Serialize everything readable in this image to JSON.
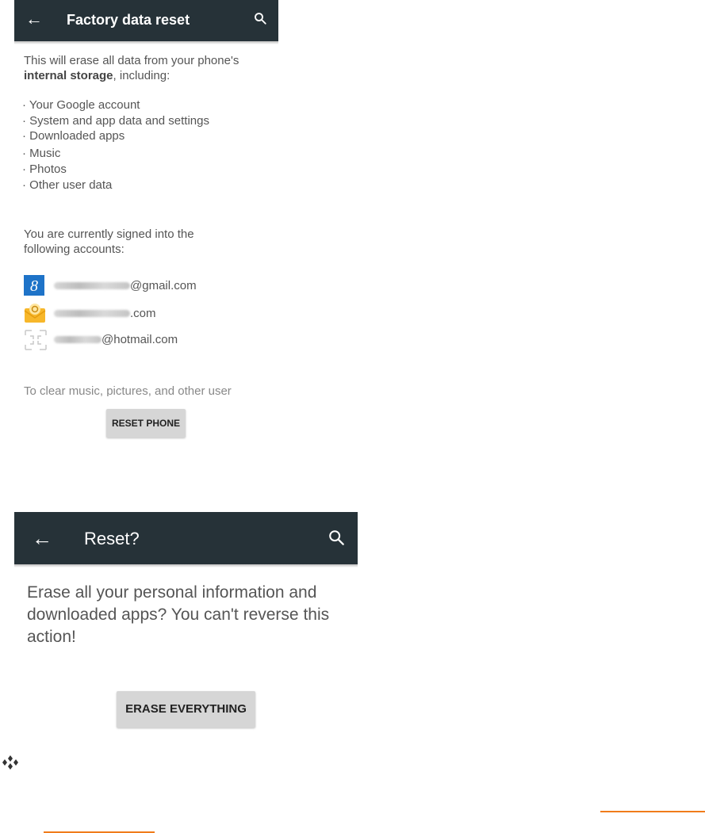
{
  "screen1": {
    "appbar": {
      "back_icon": "arrow-back-icon",
      "title": "Factory data reset",
      "search_icon": "search-icon",
      "color": "#263238"
    },
    "intro_part1": "This will erase all data from your phone's",
    "intro_bold": "internal storage",
    "intro_part2": ", including:",
    "items": [
      "Your Google account",
      "System and app data and settings",
      "Downloaded apps",
      "Music",
      "Photos",
      "Other user data"
    ],
    "signed_in_text": "You are currently signed into the following accounts:",
    "accounts": [
      {
        "icon": "google-account-icon",
        "suffix": "@gmail.com"
      },
      {
        "icon": "email-app-icon",
        "suffix": ".com"
      },
      {
        "icon": "generic-account-icon",
        "suffix": "@hotmail.com"
      }
    ],
    "cut_text": "To clear music, pictures, and other user",
    "reset_button": "RESET PHONE"
  },
  "screen2": {
    "appbar": {
      "back_icon": "arrow-back-icon",
      "title": "Reset?",
      "search_icon": "search-icon"
    },
    "message": "Erase all your personal information and downloaded apps? You can't reverse this action!",
    "erase_button": "ERASE EVERYTHING"
  },
  "colors": {
    "button": "#d6d6d6",
    "accent_line": "#f07c1b"
  }
}
